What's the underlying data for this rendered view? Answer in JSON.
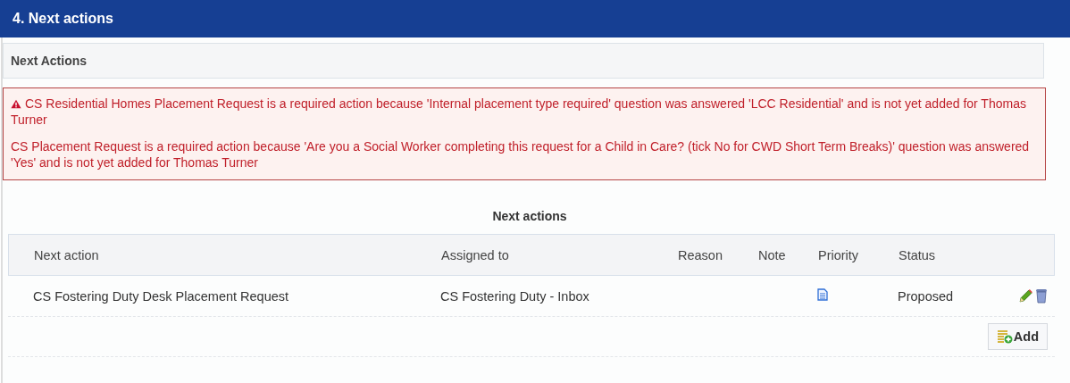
{
  "section_title": "4. Next actions",
  "panel_title": "Next Actions",
  "alerts": [
    {
      "kind": "warning",
      "text": "CS Residential Homes Placement Request is a required action because 'Internal placement type required' question was answered 'LCC Residential' and is not yet added for Thomas Turner"
    },
    {
      "kind": "plain",
      "text": "CS Placement Request is a required action because 'Are you a Social Worker completing this request for a Child in Care? (tick No for CWD Short Term Breaks)' question was answered 'Yes' and is not yet added for Thomas Turner"
    }
  ],
  "table": {
    "caption": "Next actions",
    "columns": [
      "Next action",
      "Assigned to",
      "Reason",
      "Note",
      "Priority",
      "Status"
    ],
    "rows": [
      {
        "next_action": "CS Fostering Duty Desk Placement Request",
        "assigned_to": "CS Fostering Duty - Inbox",
        "status": "Proposed"
      }
    ],
    "add_button": "Add"
  }
}
